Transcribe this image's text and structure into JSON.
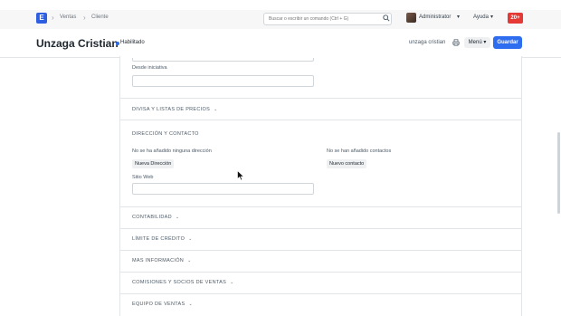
{
  "navbar": {
    "logo_letter": "E",
    "breadcrumbs": [
      "Ventas",
      "Cliente"
    ],
    "search_placeholder": "Buscar o escribir un comando (Ctrl + G)",
    "user_name": "Administrator",
    "help_label": "Ayuda",
    "notification_count": "20+"
  },
  "header": {
    "title": "Unzaga Cristian",
    "status": "Habilitado",
    "record_name": "unzaga cristian",
    "menu_label": "Menú",
    "save_label": "Guardar"
  },
  "form": {
    "desde_iniciativa_label": "Desde iniciativa",
    "sections": {
      "currency": "DIVISA Y LISTAS DE PRECIOS",
      "address_contact": "DIRECCIÓN Y CONTACTO",
      "credit": "CONTABILIDAD",
      "credit_limit": "LÍMITE DE CRÉDITO",
      "more_info": "MAS INFORMACIÓN",
      "commissions": "COMISIONES Y SOCIOS DE VENTAS",
      "sales_team": "EQUIPO DE VENTAS"
    },
    "no_address_text": "No se ha añadido ninguna dirección",
    "no_contact_text": "No se han añadido contactos",
    "new_address_label": "Nueva Dirección",
    "new_contact_label": "Nuevo contacto",
    "website_label": "Sitio Web"
  },
  "colors": {
    "primary": "#2f6df0",
    "notification": "#e53935"
  }
}
